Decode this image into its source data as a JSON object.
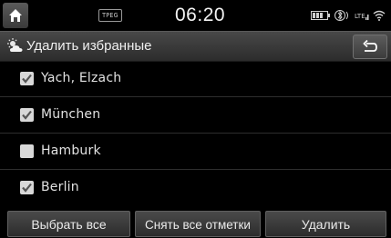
{
  "status_bar": {
    "tpeg_label": "TPEG",
    "time": "06:20",
    "icons": [
      "battery-icon",
      "bluetooth-phone-icon",
      "signal-icon",
      "wifi-icon"
    ]
  },
  "title_bar": {
    "icon": "weather-icon",
    "title": "Удалить избранные",
    "back_icon": "back-icon"
  },
  "list": {
    "items": [
      {
        "label": "Yach, Elzach",
        "checked": true
      },
      {
        "label": "München",
        "checked": true
      },
      {
        "label": "Hamburk",
        "checked": false
      },
      {
        "label": "Berlin",
        "checked": true
      }
    ]
  },
  "bottom_bar": {
    "select_all": "Выбрать все",
    "deselect_all": "Снять все отметки",
    "delete": "Удалить"
  }
}
